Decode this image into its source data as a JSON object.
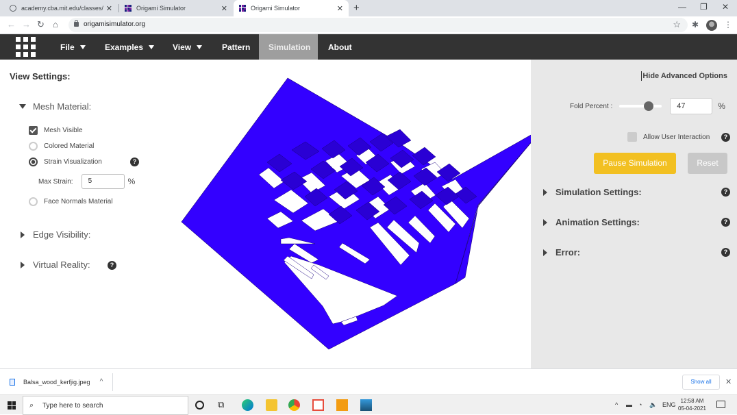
{
  "browser": {
    "tabs": [
      {
        "title": "academy.cba.mit.edu/classes/co",
        "icon": "globe-icon"
      },
      {
        "title": "Origami Simulator",
        "icon": "origami-favicon-icon"
      },
      {
        "title": "Origami Simulator",
        "icon": "origami-favicon-icon",
        "active": true
      }
    ],
    "url": "origamisimulator.org"
  },
  "nav": {
    "items": [
      {
        "label": "File",
        "dropdown": true
      },
      {
        "label": "Examples",
        "dropdown": true
      },
      {
        "label": "View",
        "dropdown": true
      },
      {
        "label": "Pattern",
        "dropdown": false
      },
      {
        "label": "Simulation",
        "dropdown": false,
        "active": true
      },
      {
        "label": "About",
        "dropdown": false
      }
    ]
  },
  "left": {
    "title": "View Settings:",
    "mesh_material": "Mesh Material:",
    "mesh_visible": "Mesh Visible",
    "colored_material": "Colored Material",
    "strain_visualization": "Strain Visualization",
    "max_strain_label": "Max Strain:",
    "max_strain_value": "5",
    "max_strain_unit": "%",
    "face_normals": "Face Normals Material",
    "edge_visibility": "Edge Visibility:",
    "virtual_reality": "Virtual Reality:",
    "help_glyph": "?"
  },
  "right": {
    "hide_advanced": "Hide Advanced Options",
    "fold_percent_label": "Fold Percent :",
    "fold_percent_value": "47",
    "fold_percent_unit": "%",
    "fold_percent_fraction": 0.47,
    "allow_user_interaction": "Allow User Interaction",
    "pause_label": "Pause Simulation",
    "reset_label": "Reset",
    "simulation_settings": "Simulation Settings:",
    "animation_settings": "Animation Settings:",
    "error": "Error:"
  },
  "model": {
    "fill_color": "#3300ff",
    "edge_color": "#1a0080"
  },
  "downloads": {
    "file": "Balsa_wood_kerfjig.jpeg",
    "show_all": "Show all"
  },
  "taskbar": {
    "search_placeholder": "Type here to search",
    "lang": "ENG",
    "time": "12:58 AM",
    "date": "05-04-2021"
  }
}
